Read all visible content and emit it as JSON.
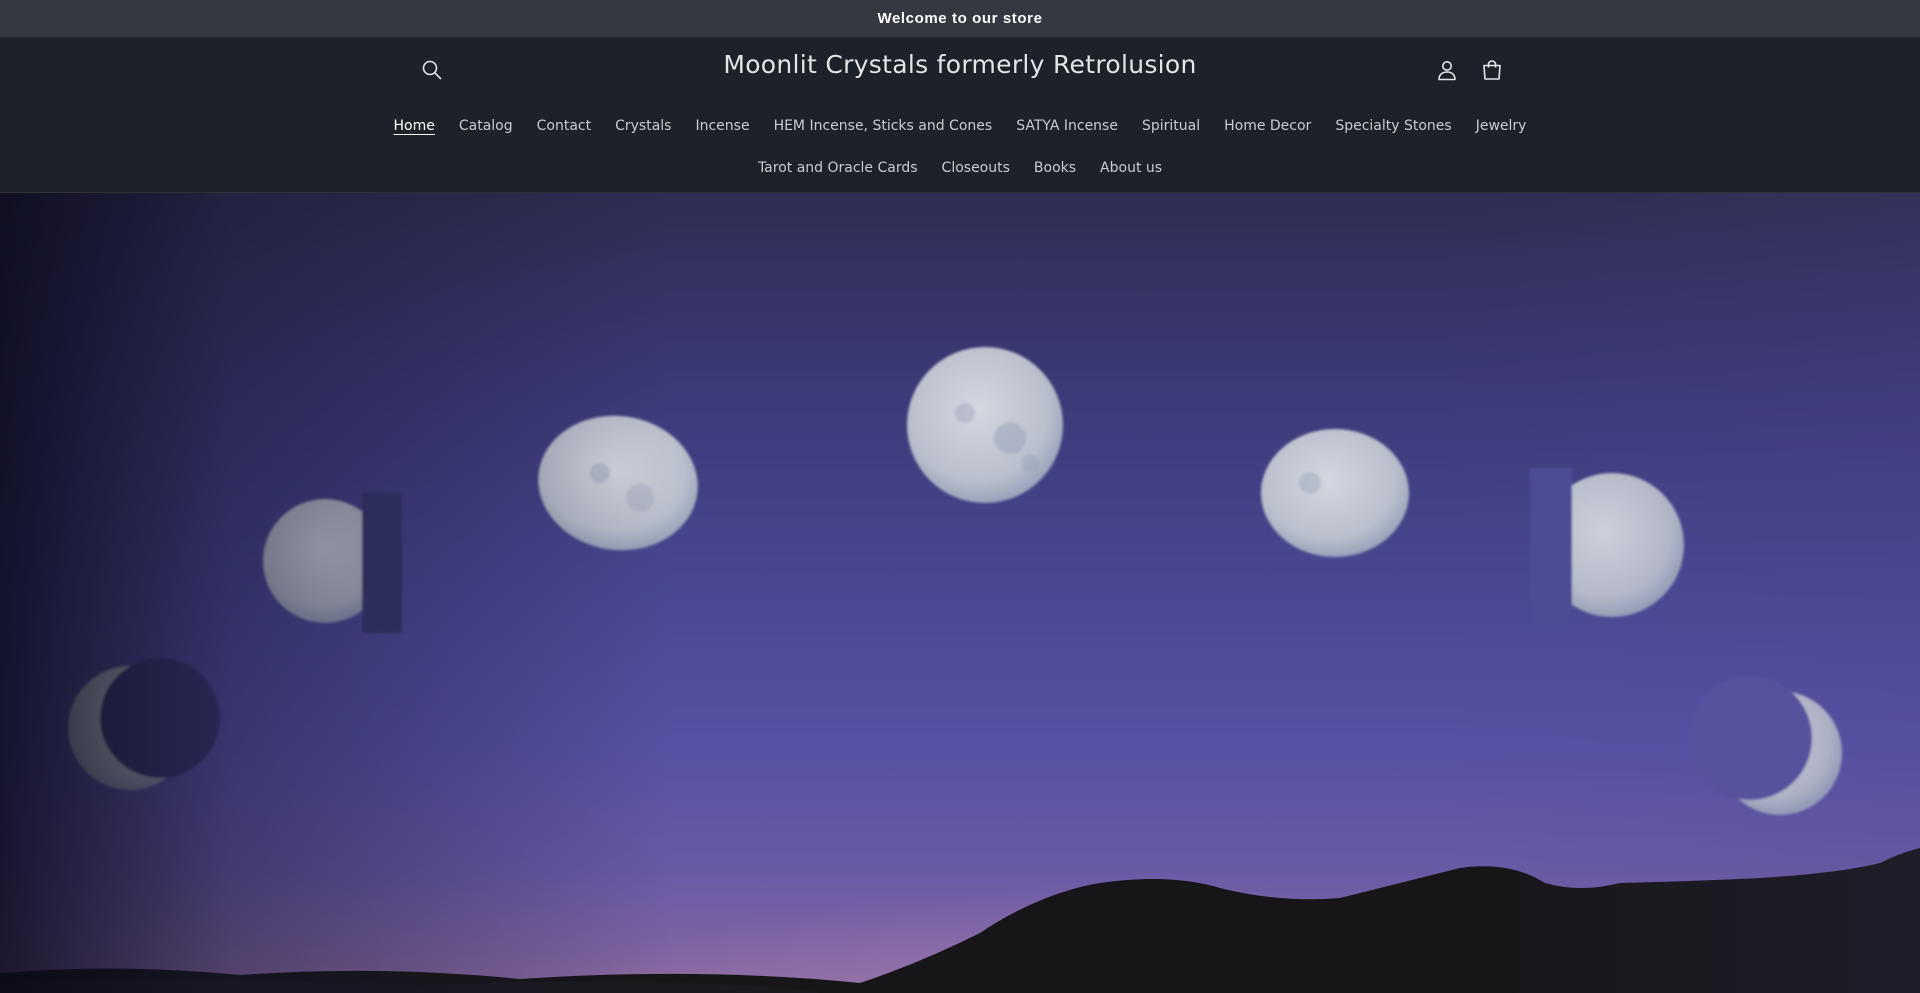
{
  "announcement": {
    "text": "Welcome to our store"
  },
  "header": {
    "title": "Moonlit Crystals formerly Retrolusion",
    "icons": {
      "search": "search-icon",
      "account": "account-icon",
      "cart": "cart-icon"
    }
  },
  "nav": {
    "row1": [
      {
        "label": "Home",
        "active": true
      },
      {
        "label": "Catalog"
      },
      {
        "label": "Contact"
      },
      {
        "label": "Crystals"
      },
      {
        "label": "Incense"
      },
      {
        "label": "HEM Incense, Sticks and Cones"
      },
      {
        "label": "SATYA Incense"
      },
      {
        "label": "Spiritual"
      },
      {
        "label": "Home Decor"
      },
      {
        "label": "Specialty Stones"
      },
      {
        "label": "Jewelry"
      }
    ],
    "row2": [
      {
        "label": "Tarot and Oracle Cards"
      },
      {
        "label": "Closeouts"
      },
      {
        "label": "Books"
      },
      {
        "label": "About us"
      }
    ]
  },
  "hero": {
    "image": "moon-phases-banner",
    "colors": {
      "sky_top": "#2f2d52",
      "sky_mid": "#4a4894",
      "sky_bottom": "#8a6aa0",
      "moon": "#c9ccd6",
      "mountains": "#161618"
    }
  }
}
